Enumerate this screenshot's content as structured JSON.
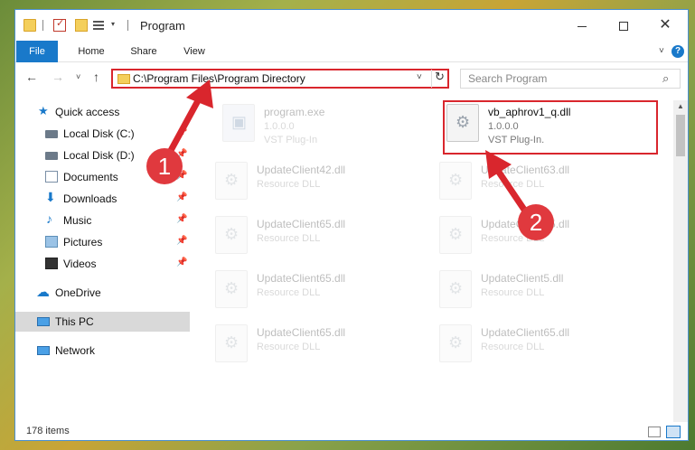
{
  "window": {
    "title": "Program",
    "controls": {
      "minimize": "—",
      "maximize": "",
      "close": "✕"
    }
  },
  "ribbon": {
    "tabs": [
      "File",
      "Home",
      "Share",
      "View"
    ],
    "collapse_glyph": "˅",
    "help_glyph": "?"
  },
  "navigation": {
    "back_glyph": "←",
    "forward_glyph": "→",
    "recent_glyph": "˅",
    "up_glyph": "↑",
    "address": "C:\\Program Files\\Program Directory",
    "address_drop_glyph": "˅",
    "refresh_glyph": "↻",
    "search_placeholder": "Search Program",
    "search_glyph": "⌕"
  },
  "sidebar": {
    "items": [
      {
        "label": "Quick access",
        "icon": "star-icon",
        "glyph": "★",
        "pinned": false
      },
      {
        "label": "Local Disk (C:)",
        "icon": "disk-icon",
        "glyph": "",
        "pinned": true
      },
      {
        "label": "Local Disk (D:)",
        "icon": "disk-icon",
        "glyph": "",
        "pinned": true
      },
      {
        "label": "Documents",
        "icon": "documents-icon",
        "glyph": "",
        "pinned": true
      },
      {
        "label": "Downloads",
        "icon": "downloads-icon",
        "glyph": "⬇",
        "pinned": true
      },
      {
        "label": "Music",
        "icon": "music-icon",
        "glyph": "♪",
        "pinned": true
      },
      {
        "label": "Pictures",
        "icon": "pictures-icon",
        "glyph": "",
        "pinned": true
      },
      {
        "label": "Videos",
        "icon": "videos-icon",
        "glyph": "",
        "pinned": true
      },
      {
        "label": "OneDrive",
        "icon": "onedrive-icon",
        "glyph": "☁",
        "pinned": false
      },
      {
        "label": "This PC",
        "icon": "pc-icon",
        "glyph": "",
        "pinned": false,
        "selected": true
      },
      {
        "label": "Network",
        "icon": "network-icon",
        "glyph": "",
        "pinned": false
      }
    ],
    "pin_glyph": "📌"
  },
  "files": [
    {
      "name": "program.exe",
      "line1": "1.0.0.0",
      "line2": "VST Plug-In",
      "faded": true
    },
    {
      "name": "vb_aphrov1_q.dll",
      "line1": "1.0.0.0",
      "line2": "VST Plug-In.",
      "faded": false,
      "highlighted": true
    },
    {
      "name": "UpdateClient42.dll",
      "line1": "Resource DLL",
      "line2": "",
      "faded": true
    },
    {
      "name": "UpdateClient63.dll",
      "line1": "Resource DLL",
      "line2": "",
      "faded": true
    },
    {
      "name": "UpdateClient65.dll",
      "line1": "Resource DLL",
      "line2": "",
      "faded": true
    },
    {
      "name": "UpdateClient65.dll",
      "line1": "Resource DLL",
      "line2": "",
      "faded": true
    },
    {
      "name": "UpdateClient65.dll",
      "line1": "Resource DLL",
      "line2": "",
      "faded": true
    },
    {
      "name": "UpdateClient5.dll",
      "line1": "Resource DLL",
      "line2": "",
      "faded": true
    },
    {
      "name": "UpdateClient65.dll",
      "line1": "Resource DLL",
      "line2": "",
      "faded": true
    },
    {
      "name": "UpdateClient65.dll",
      "line1": "Resource DLL",
      "line2": "",
      "faded": true
    }
  ],
  "status": {
    "item_count": "178 items"
  },
  "callouts": {
    "step1": "1",
    "step2": "2",
    "color": "#e0393e"
  }
}
